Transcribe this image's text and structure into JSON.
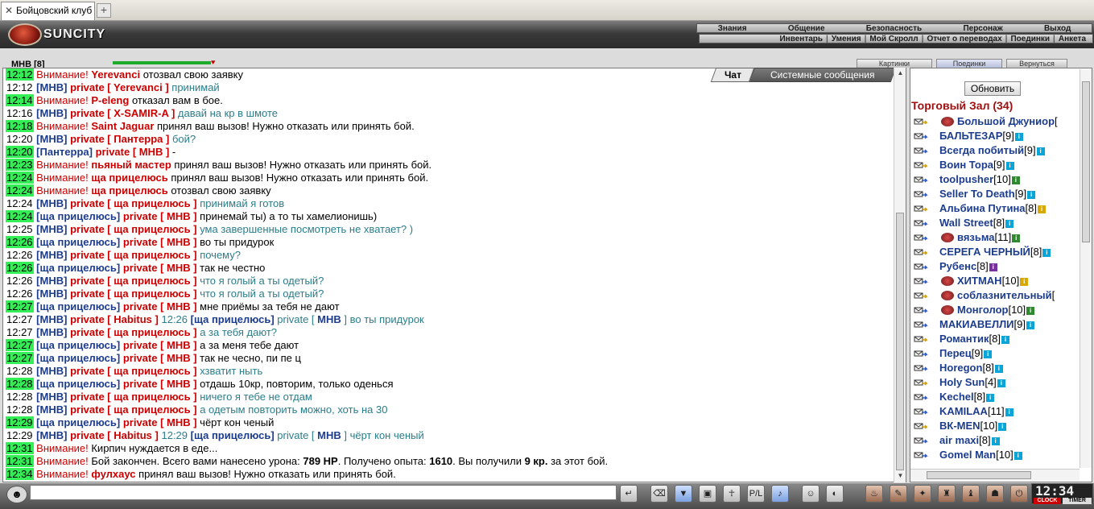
{
  "browser": {
    "tab_title": "Бойцовский клуб",
    "new_tab": "+"
  },
  "header": {
    "logo_text": "SUNCITY",
    "top_menu": [
      "Знания",
      "Общение",
      "Безопасность",
      "Персонаж",
      "Выход"
    ],
    "sub_menu": [
      "Инвентарь",
      "Умения",
      "Мой Скролл",
      "Отчет о переводах",
      "Поединки",
      "Анкета"
    ]
  },
  "status": {
    "nick": "МНВ [8]",
    "hp_fraction": 1.0,
    "buttons": [
      "Картинки",
      "Поединки",
      "Вернуться"
    ]
  },
  "chat_tabs": {
    "chat": "Чат",
    "system": "Системные сообщения"
  },
  "chat_lines": [
    {
      "time": "12:12",
      "hl": true,
      "parts": [
        [
          "warn",
          "Внимание! "
        ],
        [
          "nk",
          "Yerevanci"
        ],
        [
          "bk",
          " отозвал свою заявку"
        ]
      ]
    },
    {
      "time": "12:12",
      "hl": false,
      "parts": [
        [
          "bl",
          "[МНВ] "
        ],
        [
          "pr",
          "private [ Yerevanci ] "
        ],
        [
          "tl",
          "принимай"
        ]
      ]
    },
    {
      "time": "12:14",
      "hl": true,
      "parts": [
        [
          "warn",
          "Внимание! "
        ],
        [
          "nk",
          "P-eleng"
        ],
        [
          "bk",
          " отказал вам в бое."
        ]
      ]
    },
    {
      "time": "12:16",
      "hl": false,
      "parts": [
        [
          "bl",
          "[МНВ] "
        ],
        [
          "pr",
          "private [ X-SAMIR-A ] "
        ],
        [
          "tl",
          "давай на кр в шмоте"
        ]
      ]
    },
    {
      "time": "12:18",
      "hl": true,
      "parts": [
        [
          "warn",
          "Внимание! "
        ],
        [
          "nk",
          "Saint Jaguar"
        ],
        [
          "bk",
          " принял ваш вызов! Нужно отказать или принять бой."
        ]
      ]
    },
    {
      "time": "12:20",
      "hl": false,
      "parts": [
        [
          "bl",
          "[МНВ] "
        ],
        [
          "pr",
          "private [ Пантерра ] "
        ],
        [
          "tl",
          "бой?"
        ]
      ]
    },
    {
      "time": "12:20",
      "hl": true,
      "parts": [
        [
          "bl",
          "[Пантерра] "
        ],
        [
          "pr",
          "private [ МНВ ] "
        ],
        [
          "bk",
          "-"
        ]
      ]
    },
    {
      "time": "12:23",
      "hl": true,
      "parts": [
        [
          "warn",
          "Внимание! "
        ],
        [
          "nk",
          "пьяный мастер"
        ],
        [
          "bk",
          " принял ваш вызов! Нужно отказать или принять бой."
        ]
      ]
    },
    {
      "time": "12:24",
      "hl": true,
      "parts": [
        [
          "warn",
          "Внимание! "
        ],
        [
          "nk",
          "ща прицелюсь"
        ],
        [
          "bk",
          " принял ваш вызов! Нужно отказать или принять бой."
        ]
      ]
    },
    {
      "time": "12:24",
      "hl": true,
      "parts": [
        [
          "warn",
          "Внимание! "
        ],
        [
          "nk",
          "ща прицелюсь"
        ],
        [
          "bk",
          " отозвал свою заявку"
        ]
      ]
    },
    {
      "time": "12:24",
      "hl": false,
      "parts": [
        [
          "bl",
          "[МНВ] "
        ],
        [
          "pr",
          "private [ ща прицелюсь ] "
        ],
        [
          "tl",
          "принимай я готов"
        ]
      ]
    },
    {
      "time": "12:24",
      "hl": true,
      "parts": [
        [
          "bl",
          "[ща прицелюсь] "
        ],
        [
          "pr",
          "private [ МНВ ] "
        ],
        [
          "bk",
          "принемай ты) а то ты хамелионишь)"
        ]
      ]
    },
    {
      "time": "12:25",
      "hl": false,
      "parts": [
        [
          "bl",
          "[МНВ] "
        ],
        [
          "pr",
          "private [ ща прицелюсь ] "
        ],
        [
          "tl",
          "ума завершенные посмотреть не хватает? )"
        ]
      ]
    },
    {
      "time": "12:26",
      "hl": true,
      "parts": [
        [
          "bl",
          "[ща прицелюсь] "
        ],
        [
          "pr",
          "private [ МНВ ] "
        ],
        [
          "bk",
          "во ты придурок"
        ]
      ]
    },
    {
      "time": "12:26",
      "hl": false,
      "parts": [
        [
          "bl",
          "[МНВ] "
        ],
        [
          "pr",
          "private [ ща прицелюсь ] "
        ],
        [
          "tl",
          "почему?"
        ]
      ]
    },
    {
      "time": "12:26",
      "hl": true,
      "parts": [
        [
          "bl",
          "[ща прицелюсь] "
        ],
        [
          "pr",
          "private [ МНВ ] "
        ],
        [
          "bk",
          "так не честно"
        ]
      ]
    },
    {
      "time": "12:26",
      "hl": false,
      "parts": [
        [
          "bl",
          "[МНВ] "
        ],
        [
          "pr",
          "private [ ща прицелюсь ] "
        ],
        [
          "tl",
          "что я голый а ты одетый?"
        ]
      ]
    },
    {
      "time": "12:26",
      "hl": false,
      "parts": [
        [
          "bl",
          "[МНВ] "
        ],
        [
          "pr",
          "private [ ща прицелюсь ] "
        ],
        [
          "tl",
          "что я голый а ты одетый?"
        ]
      ]
    },
    {
      "time": "12:27",
      "hl": true,
      "parts": [
        [
          "bl",
          "[ща прицелюсь] "
        ],
        [
          "pr",
          "private [ МНВ ] "
        ],
        [
          "bk",
          "мне приёмы за тебя не дают"
        ]
      ]
    },
    {
      "time": "12:27",
      "hl": false,
      "parts": [
        [
          "bl",
          "[МНВ] "
        ],
        [
          "pr",
          "private [ Habitus ] "
        ],
        [
          "tl",
          "12:26 "
        ],
        [
          "bl",
          "[ща прицелюсь] "
        ],
        [
          "tl",
          "private [ "
        ],
        [
          "bl",
          "МНВ"
        ],
        [
          "tl",
          " ] во ты придурок"
        ]
      ]
    },
    {
      "time": "12:27",
      "hl": false,
      "parts": [
        [
          "bl",
          "[МНВ] "
        ],
        [
          "pr",
          "private [ ща прицелюсь ] "
        ],
        [
          "tl",
          "а за тебя дают?"
        ]
      ]
    },
    {
      "time": "12:27",
      "hl": true,
      "parts": [
        [
          "bl",
          "[ща прицелюсь] "
        ],
        [
          "pr",
          "private [ МНВ ] "
        ],
        [
          "bk",
          "а за меня тебе дают"
        ]
      ]
    },
    {
      "time": "12:27",
      "hl": true,
      "parts": [
        [
          "bl",
          "[ща прицелюсь] "
        ],
        [
          "pr",
          "private [ МНВ ] "
        ],
        [
          "bk",
          "так не чесно, пи пе ц"
        ]
      ]
    },
    {
      "time": "12:28",
      "hl": false,
      "parts": [
        [
          "bl",
          "[МНВ] "
        ],
        [
          "pr",
          "private [ ща прицелюсь ] "
        ],
        [
          "tl",
          "хзватит ныть"
        ]
      ]
    },
    {
      "time": "12:28",
      "hl": true,
      "parts": [
        [
          "bl",
          "[ща прицелюсь] "
        ],
        [
          "pr",
          "private [ МНВ ] "
        ],
        [
          "bk",
          "отдашь 10кр, повторим, только оденься"
        ]
      ]
    },
    {
      "time": "12:28",
      "hl": false,
      "parts": [
        [
          "bl",
          "[МНВ] "
        ],
        [
          "pr",
          "private [ ща прицелюсь ] "
        ],
        [
          "tl",
          "ничего я тебе не отдам"
        ]
      ]
    },
    {
      "time": "12:28",
      "hl": false,
      "parts": [
        [
          "bl",
          "[МНВ] "
        ],
        [
          "pr",
          "private [ ща прицелюсь ] "
        ],
        [
          "tl",
          "а одетым повторить можно, хоть на 30"
        ]
      ]
    },
    {
      "time": "12:29",
      "hl": true,
      "parts": [
        [
          "bl",
          "[ща прицелюсь] "
        ],
        [
          "pr",
          "private [ МНВ ] "
        ],
        [
          "bk",
          "чёрт кон ченый"
        ]
      ]
    },
    {
      "time": "12:29",
      "hl": false,
      "parts": [
        [
          "bl",
          "[МНВ] "
        ],
        [
          "pr",
          "private [ Habitus ] "
        ],
        [
          "tl",
          "12:29 "
        ],
        [
          "bl",
          "[ща прицелюсь] "
        ],
        [
          "tl",
          "private [ "
        ],
        [
          "bl",
          "МНВ"
        ],
        [
          "tl",
          " ] чёрт кон ченый"
        ]
      ]
    },
    {
      "time": "12:31",
      "hl": true,
      "parts": [
        [
          "warn",
          "Внимание! "
        ],
        [
          "bk",
          "Кирпич нуждается в еде..."
        ]
      ]
    },
    {
      "time": "12:31",
      "hl": true,
      "parts": [
        [
          "warn",
          "Внимание! "
        ],
        [
          "bk",
          "Бой закончен. Всего вами нанесено урона: "
        ],
        [
          "bkb",
          "789 HP"
        ],
        [
          "bk",
          ". Получено опыта: "
        ],
        [
          "bkb",
          "1610"
        ],
        [
          "bk",
          ". Вы получили "
        ],
        [
          "bkb",
          "9 кр."
        ],
        [
          "bk",
          " за этот бой."
        ]
      ]
    },
    {
      "time": "12:34",
      "hl": true,
      "parts": [
        [
          "warn",
          "Внимание! "
        ],
        [
          "nk",
          "фулхаус"
        ],
        [
          "bk",
          " принял ваш вызов! Нужно отказать или принять бой."
        ]
      ]
    }
  ],
  "right_panel": {
    "refresh_label": "Обновить",
    "room_title": "Торговый Зал (34)",
    "users": [
      {
        "name": "Большой Джуниор",
        "level": "[",
        "icon": "",
        "extra": true
      },
      {
        "name": "БАЛЬТЕЗАР",
        "level": "[9]",
        "icon": "b"
      },
      {
        "name": "Всегда побитый",
        "level": "[9]",
        "icon": "b"
      },
      {
        "name": "Воин Тора",
        "level": "[9]",
        "icon": "b"
      },
      {
        "name": "toolpusher",
        "level": "[10]",
        "icon": "g"
      },
      {
        "name": "Seller To Death",
        "level": "[9]",
        "icon": "b"
      },
      {
        "name": "Альбина Путина",
        "level": "[8]",
        "icon": "y"
      },
      {
        "name": "Wall Street",
        "level": "[8]",
        "icon": "b"
      },
      {
        "name": "вязьма",
        "level": "[11]",
        "icon": "g",
        "extra": true
      },
      {
        "name": "СЕРЕГА ЧЕРНЫЙ",
        "level": "[8]",
        "icon": "b"
      },
      {
        "name": "Рубенс",
        "level": "[8]",
        "icon": "p"
      },
      {
        "name": "ХИТМАН",
        "level": "[10]",
        "icon": "y",
        "extra": true
      },
      {
        "name": "соблазнительный",
        "level": "[",
        "icon": "",
        "extra": true
      },
      {
        "name": "Монголор",
        "level": "[10]",
        "icon": "g",
        "extra": true
      },
      {
        "name": "МАКИАВЕЛЛИ",
        "level": "[9]",
        "icon": "b"
      },
      {
        "name": "Романтик",
        "level": "[8]",
        "icon": "b"
      },
      {
        "name": "Перец",
        "level": "[9]",
        "icon": "b"
      },
      {
        "name": "Horegon",
        "level": "[8]",
        "icon": "b"
      },
      {
        "name": "Holy Sun",
        "level": "[4]",
        "icon": "b"
      },
      {
        "name": "Kechel",
        "level": "[8]",
        "icon": "b"
      },
      {
        "name": "KAMILAA",
        "level": "[11]",
        "icon": "b"
      },
      {
        "name": "ВК-MEN",
        "level": "[10]",
        "icon": "b"
      },
      {
        "name": "air maxi",
        "level": "[8]",
        "icon": "b"
      },
      {
        "name": "Gomel Man",
        "level": "[10]",
        "icon": "b"
      }
    ]
  },
  "bottom": {
    "input_value": "",
    "clock_time": "12:34",
    "clock_label": "CLOCK",
    "timer_label": "TIMER"
  }
}
